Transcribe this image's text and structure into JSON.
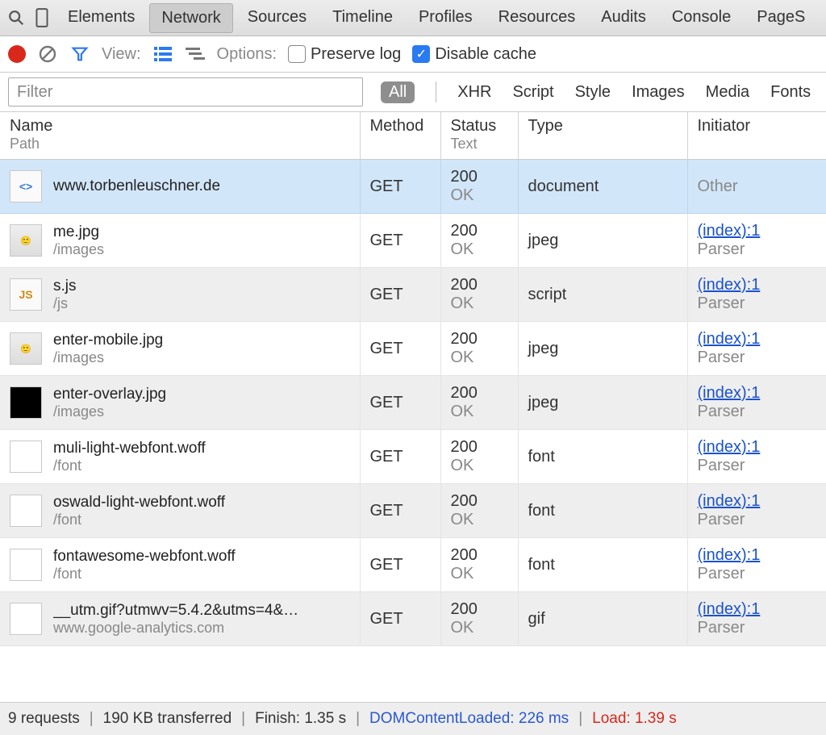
{
  "topTabs": [
    "Elements",
    "Network",
    "Sources",
    "Timeline",
    "Profiles",
    "Resources",
    "Audits",
    "Console",
    "PageS"
  ],
  "activeTopTabIndex": 1,
  "toolbar": {
    "viewLabel": "View:",
    "optionsLabel": "Options:",
    "preserveLogLabel": "Preserve log",
    "disableCacheLabel": "Disable cache",
    "preserveLogChecked": false,
    "disableCacheChecked": true
  },
  "filter": {
    "placeholder": "Filter",
    "value": "",
    "tabs": [
      "All",
      "XHR",
      "Script",
      "Style",
      "Images",
      "Media",
      "Fonts"
    ],
    "activeIndex": 0
  },
  "columns": {
    "name": {
      "h": "Name",
      "sub": "Path"
    },
    "method": {
      "h": "Method"
    },
    "status": {
      "h": "Status",
      "sub": "Text"
    },
    "type": {
      "h": "Type"
    },
    "initiator": {
      "h": "Initiator"
    }
  },
  "rows": [
    {
      "selected": true,
      "thumb": "doc",
      "name": "www.torbenleuschner.de",
      "path": "",
      "method": "GET",
      "status": "200",
      "statusText": "OK",
      "type": "document",
      "initiator": "Other",
      "initiatorLink": false,
      "initiatorSub": ""
    },
    {
      "thumb": "photo",
      "name": "me.jpg",
      "path": "/images",
      "method": "GET",
      "status": "200",
      "statusText": "OK",
      "type": "jpeg",
      "initiator": "(index):1",
      "initiatorLink": true,
      "initiatorSub": "Parser"
    },
    {
      "thumb": "js",
      "name": "s.js",
      "path": "/js",
      "method": "GET",
      "status": "200",
      "statusText": "OK",
      "type": "script",
      "initiator": "(index):1",
      "initiatorLink": true,
      "initiatorSub": "Parser"
    },
    {
      "thumb": "photo",
      "name": "enter-mobile.jpg",
      "path": "/images",
      "method": "GET",
      "status": "200",
      "statusText": "OK",
      "type": "jpeg",
      "initiator": "(index):1",
      "initiatorLink": true,
      "initiatorSub": "Parser"
    },
    {
      "thumb": "black",
      "name": "enter-overlay.jpg",
      "path": "/images",
      "method": "GET",
      "status": "200",
      "statusText": "OK",
      "type": "jpeg",
      "initiator": "(index):1",
      "initiatorLink": true,
      "initiatorSub": "Parser"
    },
    {
      "thumb": "blank",
      "name": "muli-light-webfont.woff",
      "path": "/font",
      "method": "GET",
      "status": "200",
      "statusText": "OK",
      "type": "font",
      "initiator": "(index):1",
      "initiatorLink": true,
      "initiatorSub": "Parser"
    },
    {
      "thumb": "blank",
      "name": "oswald-light-webfont.woff",
      "path": "/font",
      "method": "GET",
      "status": "200",
      "statusText": "OK",
      "type": "font",
      "initiator": "(index):1",
      "initiatorLink": true,
      "initiatorSub": "Parser"
    },
    {
      "thumb": "blank",
      "name": "fontawesome-webfont.woff",
      "path": "/font",
      "method": "GET",
      "status": "200",
      "statusText": "OK",
      "type": "font",
      "initiator": "(index):1",
      "initiatorLink": true,
      "initiatorSub": "Parser"
    },
    {
      "thumb": "blank",
      "name": "__utm.gif?utmwv=5.4.2&utms=4&…",
      "path": "www.google-analytics.com",
      "method": "GET",
      "status": "200",
      "statusText": "OK",
      "type": "gif",
      "initiator": "(index):1",
      "initiatorLink": true,
      "initiatorSub": "Parser"
    }
  ],
  "status": {
    "requests": "9 requests",
    "transferred": "190 KB transferred",
    "finish": "Finish: 1.35 s",
    "dclLabel": "DOMContentLoaded:",
    "dclValue": "226 ms",
    "loadLabel": "Load:",
    "loadValue": "1.39 s"
  }
}
